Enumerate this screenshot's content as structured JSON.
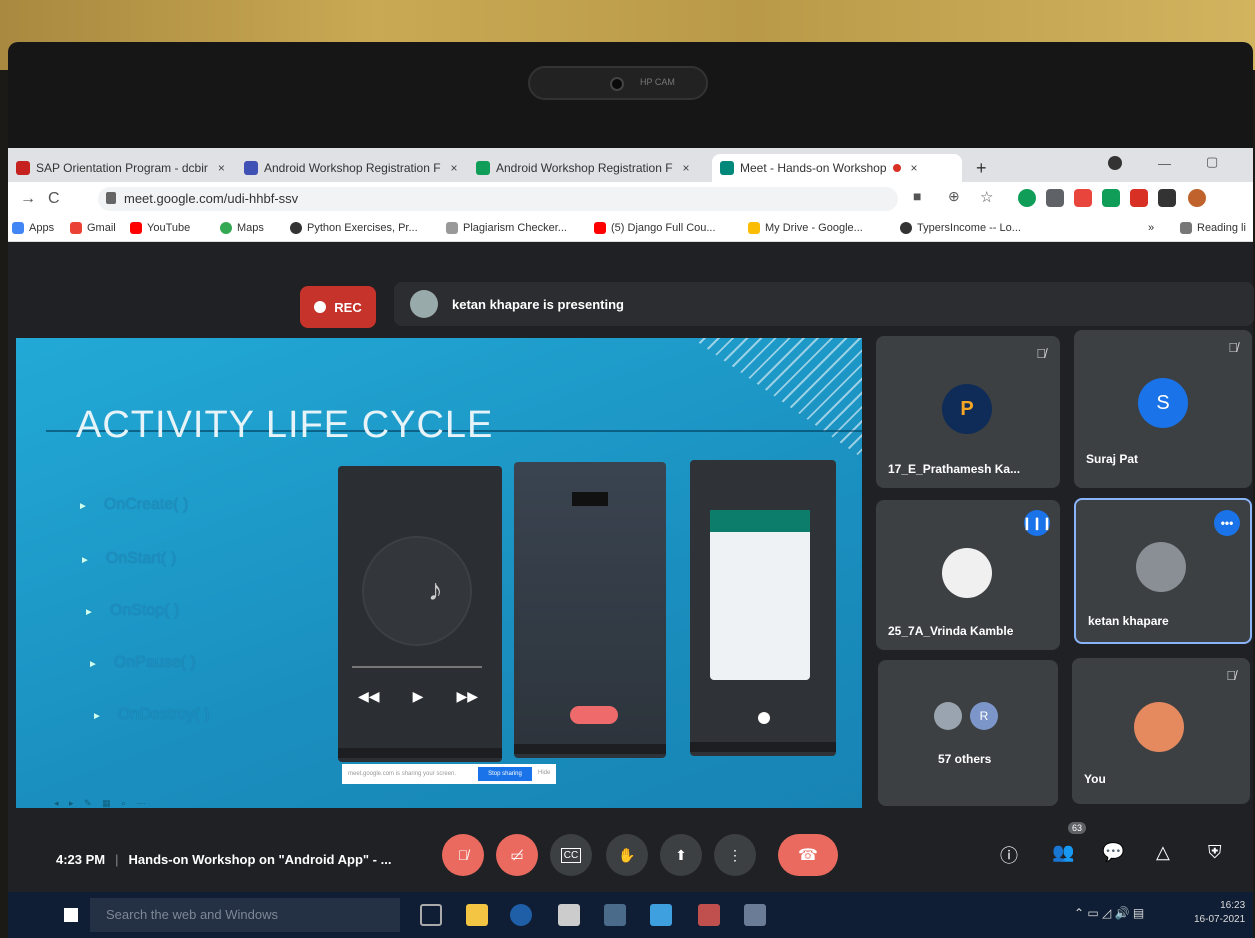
{
  "browser": {
    "tabs": [
      {
        "label": "SAP Orientation Program - dcbir",
        "close": "×",
        "favicon_color": "#c5221f"
      },
      {
        "label": "Android Workshop Registration F",
        "close": "×",
        "favicon_color": "#3f51b5"
      },
      {
        "label": "Android Workshop Registration F",
        "close": "×",
        "favicon_color": "#0f9d58"
      },
      {
        "label": "Meet - Hands-on Workshop",
        "close": "×",
        "favicon_color": "#00897b",
        "active": true
      }
    ],
    "new_tab": "+",
    "url": "meet.google.com/udi-hhbf-ssv",
    "bookmarks": [
      {
        "label": "Apps",
        "color": "#4285f4"
      },
      {
        "label": "Gmail",
        "color": "#ea4335"
      },
      {
        "label": "YouTube",
        "color": "#ff0000"
      },
      {
        "label": "Maps",
        "color": "#34a853"
      },
      {
        "label": "Python Exercises, Pr...",
        "color": "#333333"
      },
      {
        "label": "Plagiarism Checker...",
        "color": "#999999"
      },
      {
        "label": "(5) Django Full Cou...",
        "color": "#ff0000"
      },
      {
        "label": "My Drive - Google...",
        "color": "#fbbc04"
      },
      {
        "label": "TypersIncome -- Lo...",
        "color": "#333333"
      }
    ],
    "reading_list": "Reading li",
    "more_bookmarks": "»"
  },
  "meet": {
    "rec_label": "REC",
    "presenting": "ketan khapare is presenting",
    "slide": {
      "title": "ACTIVITY LIFE CYCLE",
      "bullets": [
        "OnCreate( )",
        "OnStart( )",
        "OnStop( )",
        "OnPause( )",
        "OnDestroy( )"
      ],
      "share_prompt": "meet.google.com is sharing your screen.",
      "share_button": "Stop sharing",
      "share_hide": "Hide"
    },
    "tiles": [
      {
        "name": "17_E_Prathamesh Ka...",
        "avatar": "P",
        "color": "#0f2b57",
        "muted": true
      },
      {
        "name": "Suraj Pat",
        "avatar": "S",
        "color": "#1a73e8",
        "muted": true
      },
      {
        "name": "25_7A_Vrinda Kamble",
        "avatar": "",
        "color": "#f0f0f0",
        "speaking": true
      },
      {
        "name": "ketan khapare",
        "avatar": "",
        "color": "#8a8f95",
        "more": "•••"
      },
      {
        "name": "57 others",
        "avatar": "R",
        "color": "#7c96c9"
      },
      {
        "name": "You",
        "avatar": "",
        "color": "#e5895f",
        "muted": true
      }
    ],
    "bottom": {
      "time": "4:23 PM",
      "title": "Hands-on Workshop on \"Android App\" - ...",
      "participants_count": "63",
      "mic_icon": "mic-off-icon",
      "cam_icon": "camera-off-icon"
    }
  },
  "taskbar": {
    "search_placeholder": "Search the web and Windows",
    "time": "16:23",
    "date": "16-07-2021"
  }
}
